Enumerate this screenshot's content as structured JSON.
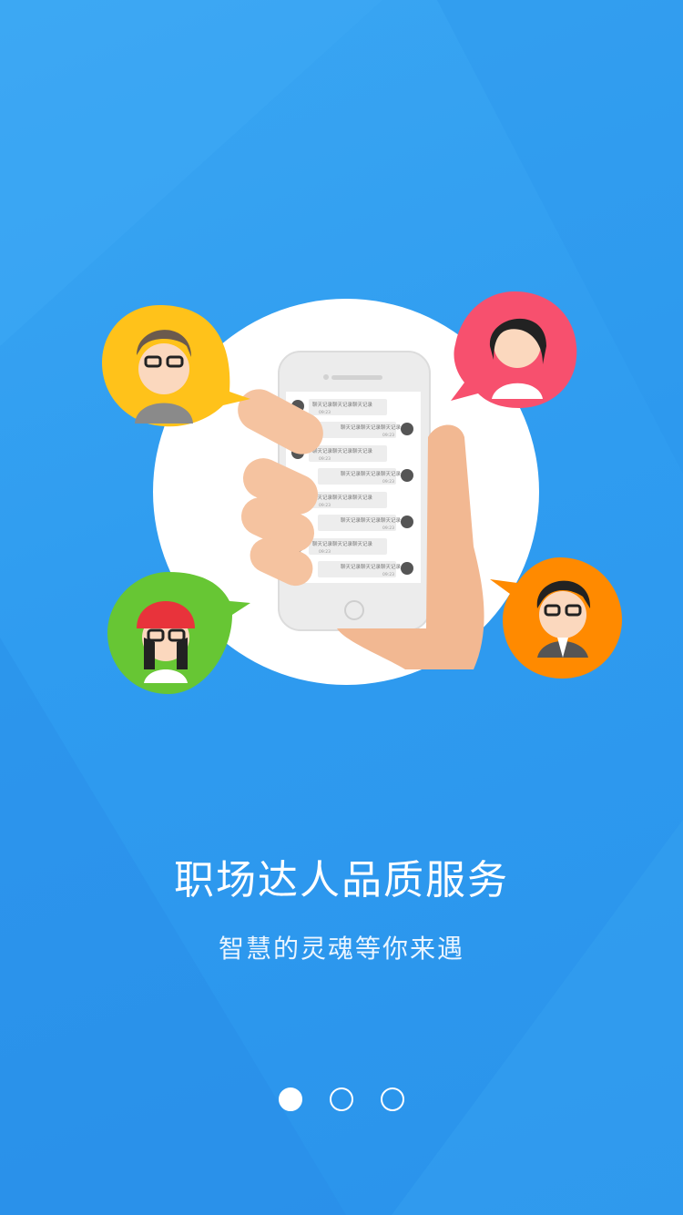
{
  "onboarding": {
    "title": "职场达人品质服务",
    "subtitle": "智慧的灵魂等你来遇"
  },
  "illustration": {
    "chat_bubble_text_left": "聊天记录聊天记录聊天记录",
    "chat_bubble_text_right": "聊天记录聊天记录聊天记录",
    "chat_time": "09:23"
  },
  "pager": {
    "page_count": 3,
    "active_index": 0
  },
  "colors": {
    "background": "#2f9cf0",
    "avatar_yellow": "#ffc21a",
    "avatar_red": "#f7506e",
    "avatar_green": "#67c634",
    "avatar_orange": "#ff8a00"
  }
}
